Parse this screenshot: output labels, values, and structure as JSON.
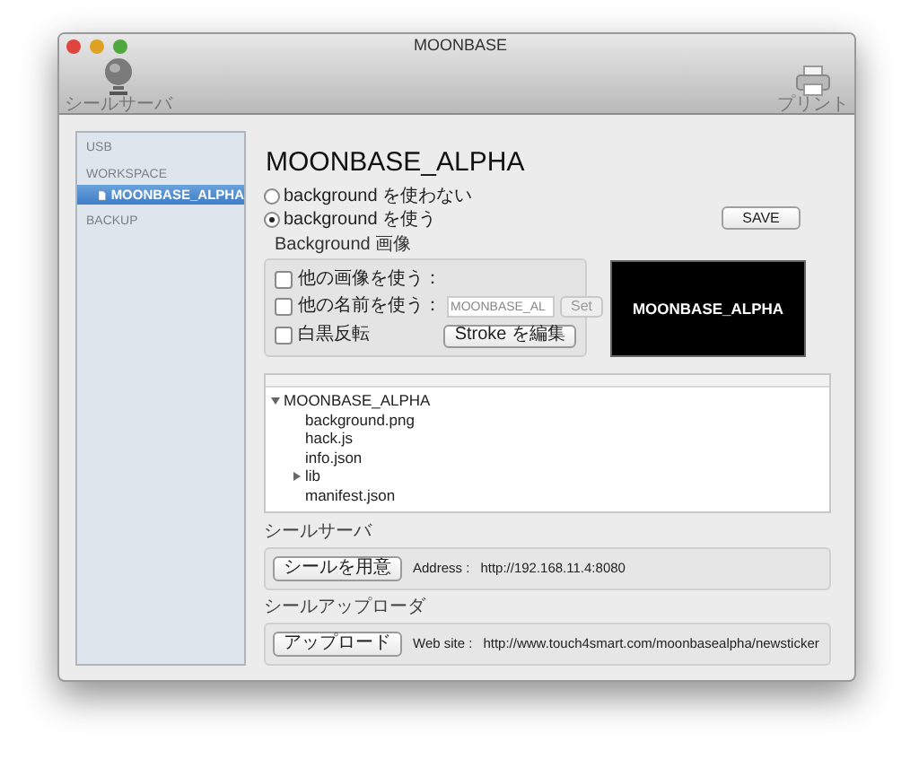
{
  "window": {
    "title": "MOONBASE"
  },
  "toolbar": [
    {
      "label": "シールサーバ",
      "kind": "globe"
    },
    {
      "label": "プリント",
      "kind": "printer"
    }
  ],
  "sidebar": {
    "groups": [
      {
        "label": "USB"
      },
      {
        "label": "WORKSPACE",
        "items": [
          {
            "label": "MOONBASE_ALPHA",
            "selected": true
          }
        ]
      },
      {
        "label": "BACKUP"
      }
    ]
  },
  "main": {
    "title": "MOONBASE_ALPHA",
    "radios": [
      {
        "label": "background を使わない",
        "selected": false
      },
      {
        "label": "background を使う",
        "selected": true
      }
    ],
    "save_button": "SAVE",
    "background_group": {
      "title": "Background 画像",
      "use_other_image": {
        "label": "他の画像を使う：",
        "checked": false
      },
      "use_other_name": {
        "label": "他の名前を使う：",
        "checked": false,
        "placeholder": "MOONBASE_AL",
        "button": "Set",
        "button_disabled": true
      },
      "invert": {
        "label": "白黒反転",
        "checked": false
      },
      "stroke_button": "Stroke を編集"
    },
    "preview": {
      "text": "MOONBASE_ALPHA"
    },
    "tree": [
      {
        "label": "MOONBASE_ALPHA",
        "kind": "folder",
        "expanded": true,
        "children": [
          {
            "label": "background.png",
            "kind": "file"
          },
          {
            "label": "hack.js",
            "kind": "file"
          },
          {
            "label": "info.json",
            "kind": "file"
          },
          {
            "label": "lib",
            "kind": "folder",
            "expanded": false
          },
          {
            "label": "manifest.json",
            "kind": "file"
          }
        ]
      }
    ],
    "server": {
      "title": "シールサーバ",
      "button": "シールを用意",
      "label": "Address :",
      "value": "http://192.168.11.4:8080"
    },
    "uploader": {
      "title": "シールアップローダ",
      "button": "アップロード",
      "label": "Web site :",
      "value": "http://www.touch4smart.com/moonbasealpha/newsticker"
    }
  }
}
